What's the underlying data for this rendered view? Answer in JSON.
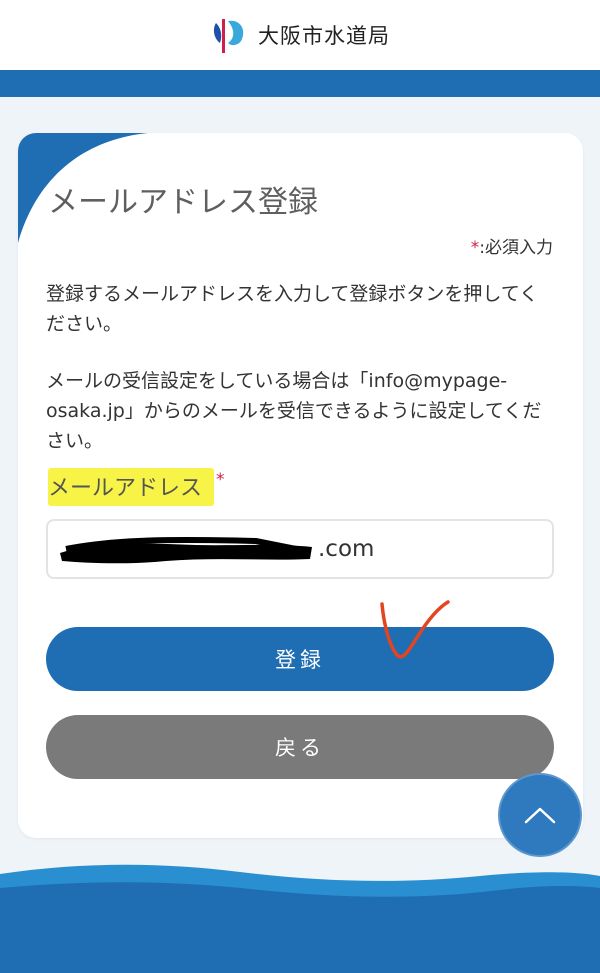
{
  "header": {
    "logo_icon": "osaka-waterworks-logo",
    "logo_text": "大阪市水道局"
  },
  "form": {
    "title": "メールアドレス登録",
    "required_mark": "*",
    "required_note": ":必須入力",
    "description_1": "登録するメールアドレスを入力して登録ボタンを押してください。",
    "description_2": "メールの受信設定をしている場合は「info@mypage-osaka.jp」からのメールを受信できるように設定してください。",
    "email_label": "メールアドレス",
    "email_required_mark": "*",
    "email_value": ".com",
    "register_label": "登録",
    "back_label": "戻る"
  },
  "scroll_top": {
    "icon": "chevron-up-icon"
  },
  "colors": {
    "brand_blue": "#1f6db3",
    "back_gray": "#7a7a7a",
    "required_red": "#d0204a",
    "highlight_yellow": "#f7f447"
  }
}
